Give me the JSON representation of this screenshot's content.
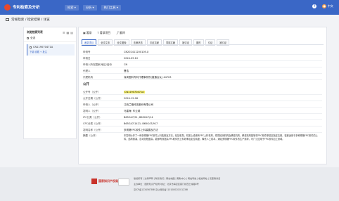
{
  "topbar": {
    "brand": "专利检索及分析",
    "nav": [
      "检索 ▾",
      "分析 ▾",
      "热门工具 ▾"
    ],
    "help_icon": "?",
    "user": "中文"
  },
  "breadcrumb": "常规检索 / 检索结果 / 详览",
  "left_panel": {
    "title": "浏览检索列表",
    "select_all": "全选",
    "item": {
      "number": "CN119070471A",
      "links": [
        "下载",
        "收藏",
        "+ 批注"
      ]
    }
  },
  "toolbar": [
    "▣ 著录",
    "T 著录项目",
    "⤴ 翻译"
  ],
  "tabs": [
    "著录项目",
    "全文文本",
    "全文图像",
    "法律状态",
    "引证文献",
    "同族文献",
    "被引证",
    "图形",
    "引证",
    "被引证"
  ],
  "sections": {
    "application": "申请",
    "publication": "公开"
  },
  "fields_application": [
    {
      "k": "申请号",
      "v": "CN202411200105.X"
    },
    {
      "k": "申请日",
      "v": "2024.09.10"
    },
    {
      "k": "申请人所在国家/地区/省份",
      "v": "CN"
    },
    {
      "k": "代理人",
      "v": "曹浩"
    },
    {
      "k": "代理机构",
      "v": "深圳国科专利代理事务所(普通合伙) 44703"
    }
  ],
  "fields_publication": [
    {
      "k": "公开号（公开）",
      "v": "CN119070471A",
      "hl": true
    },
    {
      "k": "公开日期（公开）",
      "v": "2024.12.06"
    },
    {
      "k": "申请人（公开）",
      "v": "江西兰格科技股份有限公司"
    },
    {
      "k": "发明人（公开）",
      "v": "马建海; 车云城"
    },
    {
      "k": "IPC分类（公开）",
      "v": "B65G47/91; B65G47/14"
    },
    {
      "k": "CPC分类（公开）",
      "v": "B65G47/1421; B65G47/917"
    },
    {
      "k": "发明名称（公开）",
      "v": "多规格FPC软件上料装置及方法"
    }
  ],
  "abstract_key": "摘要（公开）",
  "abstract": "本发明公开了一种多规格FPC软件上料装置及方法，包括机架，机架上设置有FPC上料机构、视觉检测机构及移载机构，移载机构能够将FPC软件移送至指定位置，装置适用于多种规格FPC软件的上料，结构紧凑，自动化程度高，能够有效提高FPC软件的上料效率及定位精度，降低人工成本，满足多规格FPC软件的生产需求，可广泛应用于FPC软件加工领域。",
  "footer": {
    "logo_text": "国家知识产权局",
    "lines": [
      "版权所有 | 法律声明 | 联系我们 | 网站地图 | 帮助中心 | 网站导航 | 相关网站 | 无障碍浏览",
      "主办单位：国家知识产权局  地址：北京市海淀区蓟门桥西土城路6号",
      "京ICP备12345678号  京公网安备11010802020123号"
    ]
  }
}
